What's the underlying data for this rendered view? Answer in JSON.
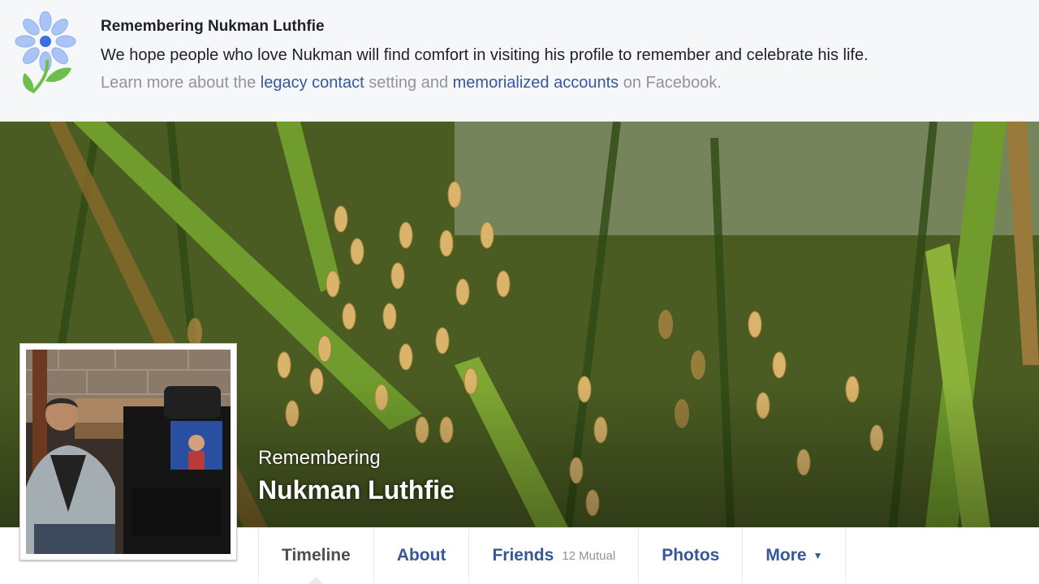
{
  "banner": {
    "title": "Remembering Nukman Luthfie",
    "message": "We hope people who love Nukman will find comfort in visiting his profile to remember and celebrate his life.",
    "learn_prefix": "Learn more about the ",
    "legacy_link": "legacy contact",
    "learn_middle": " setting and ",
    "memorial_link": "memorialized accounts",
    "learn_suffix": " on Facebook.",
    "icon": "flower-icon"
  },
  "cover": {
    "prefix": "Remembering",
    "name": "Nukman Luthfie"
  },
  "nav": {
    "tabs": [
      {
        "label": "Timeline",
        "active": true
      },
      {
        "label": "About"
      },
      {
        "label": "Friends",
        "sub": "12 Mutual"
      },
      {
        "label": "Photos"
      },
      {
        "label": "More",
        "icon": "caret-down-icon"
      }
    ]
  },
  "colors": {
    "link": "#365899",
    "muted": "#90949c",
    "text": "#1d2129"
  }
}
